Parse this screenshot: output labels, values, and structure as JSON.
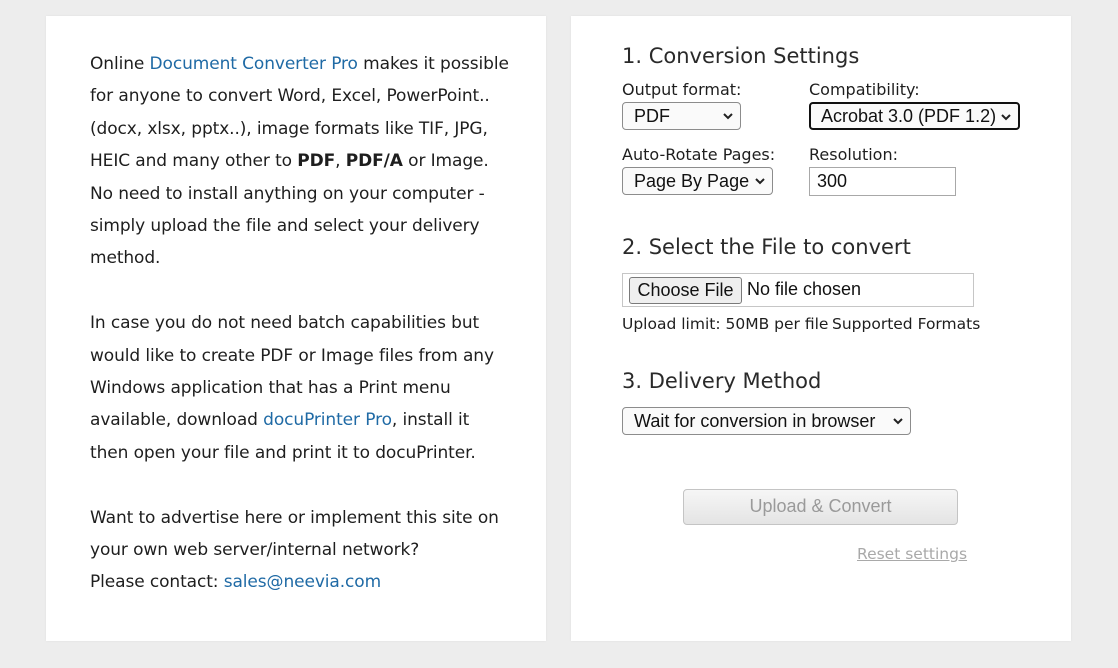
{
  "intro": {
    "p1": {
      "pre": "Online ",
      "link": "Document Converter Pro",
      "mid": " makes it possible for anyone to convert Word, Excel, PowerPoint.. (docx, xlsx, pptx..), image formats like TIF, JPG, HEIC and many other to ",
      "bold1": "PDF",
      "comma": ", ",
      "bold2": "PDF/A",
      "post": " or Image."
    },
    "p2": "No need to install anything on your computer - simply upload the file and select your delivery method.",
    "p3": {
      "pre": "In case you do not need batch capabilities but would like to create PDF or Image files from any Windows application that has a Print menu available, download ",
      "link": "docuPrinter Pro",
      "post": ", install it then open your file and print it to docuPrinter."
    },
    "p4": "Want to advertise here or implement this site on your own web server/internal network?",
    "p5": {
      "pre": "Please contact: ",
      "link": "sales@neevia.com"
    }
  },
  "settings": {
    "title": "1. Conversion Settings",
    "output_format": {
      "label": "Output format:",
      "value": "PDF"
    },
    "compatibility": {
      "label": "Compatibility:",
      "value": "Acrobat 3.0 (PDF 1.2)"
    },
    "auto_rotate": {
      "label": "Auto-Rotate Pages:",
      "value": "Page By Page"
    },
    "resolution": {
      "label": "Resolution:",
      "value": "300"
    }
  },
  "file": {
    "title": "2. Select the File to convert",
    "choose_label": "Choose File",
    "status": "No file chosen",
    "upload_limit": "Upload limit: 50MB per file",
    "supported_formats": "Supported Formats"
  },
  "delivery": {
    "title": "3. Delivery Method",
    "value": "Wait for conversion in browser"
  },
  "actions": {
    "upload_label": "Upload & Convert",
    "reset_label": "Reset settings"
  },
  "colors": {
    "link": "#1f6aa5",
    "background": "#ededed",
    "panel": "#ffffff",
    "disabled_text": "#9a9a9a"
  }
}
